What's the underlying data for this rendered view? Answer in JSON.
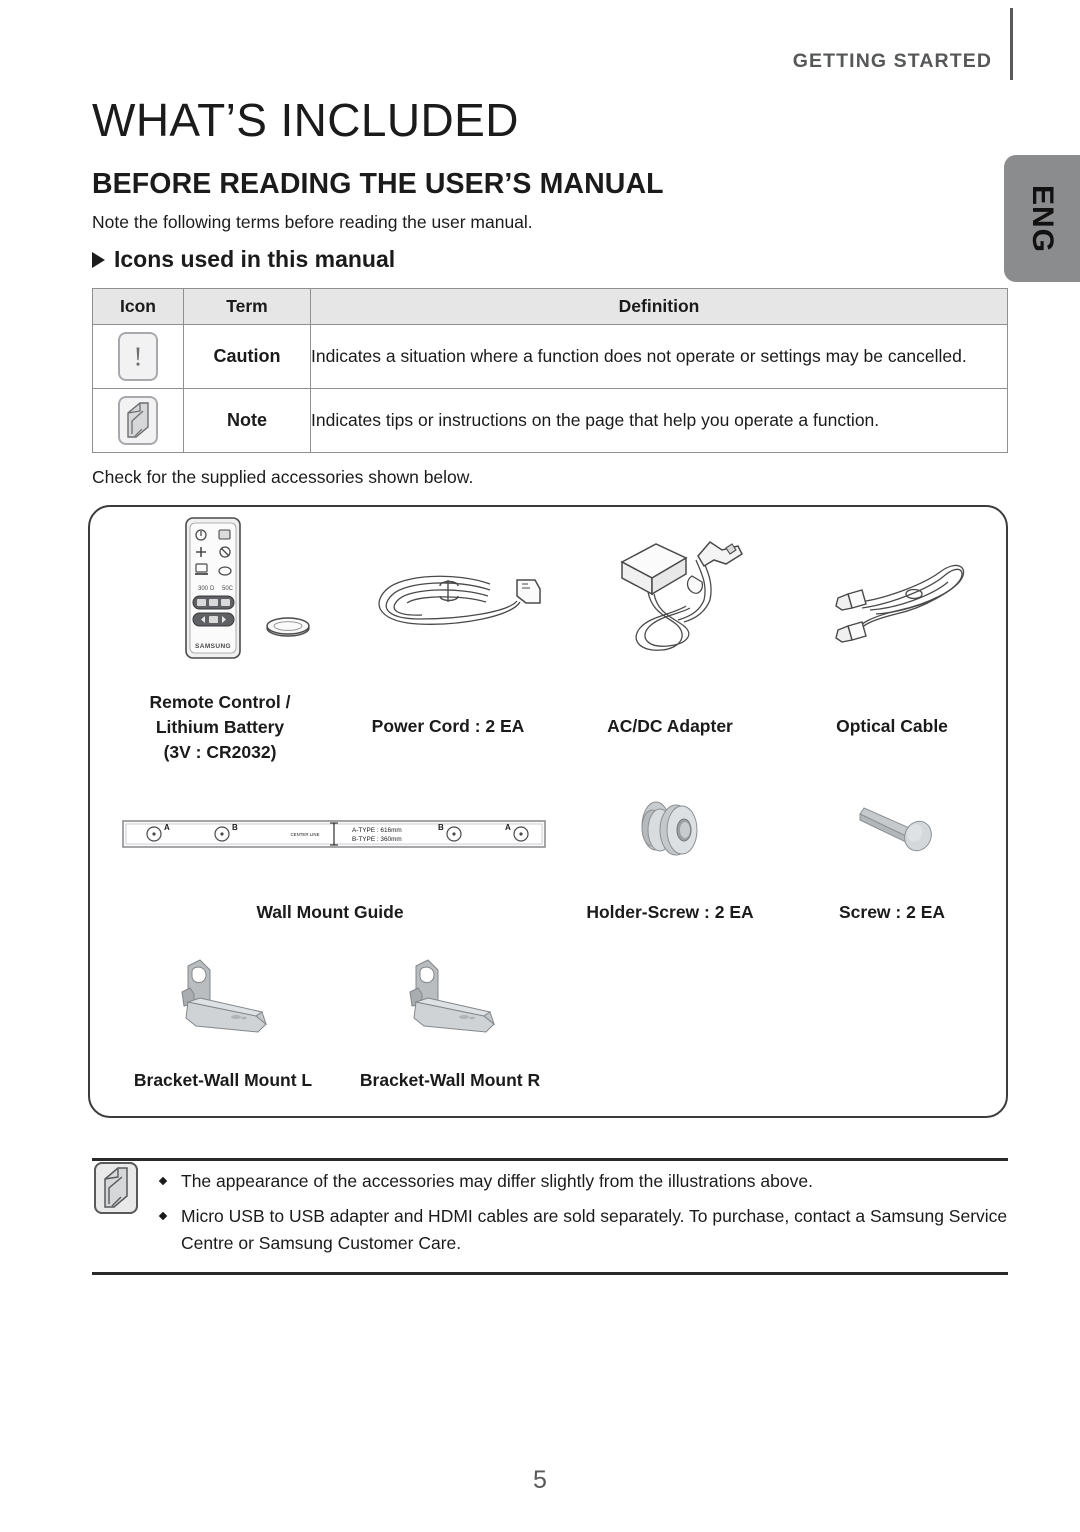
{
  "header": {
    "running_head": "GETTING STARTED",
    "language_tab": "ENG"
  },
  "page_title": "WHAT’S INCLUDED",
  "section_title": "BEFORE READING THE USER’S MANUAL",
  "intro_text": "Note the following terms before reading the user manual.",
  "subhead": "Icons used in this manual",
  "icon_table": {
    "headers": [
      "Icon",
      "Term",
      "Definition"
    ],
    "rows": [
      {
        "icon": "caution-icon",
        "term": "Caution",
        "definition": "Indicates a situation where a function does not operate or settings may be cancelled."
      },
      {
        "icon": "note-icon",
        "term": "Note",
        "definition": "Indicates tips or instructions on the page that help you operate a function."
      }
    ]
  },
  "check_text": "Check for the supplied accessories shown below.",
  "accessories": [
    {
      "icon": "remote-control-icon",
      "label": "Remote Control /\nLithium Battery\n(3V : CR2032)"
    },
    {
      "icon": "power-cord-icon",
      "label": "Power Cord : 2 EA"
    },
    {
      "icon": "ac-dc-adapter-icon",
      "label": "AC/DC Adapter"
    },
    {
      "icon": "optical-cable-icon",
      "label": "Optical Cable"
    },
    {
      "icon": "wall-mount-guide-icon",
      "label": "Wall Mount Guide"
    },
    {
      "icon": "holder-screw-icon",
      "label": "Holder-Screw : 2 EA"
    },
    {
      "icon": "screw-icon",
      "label": "Screw : 2 EA"
    },
    {
      "icon": "bracket-wall-mount-l-icon",
      "label": "Bracket-Wall Mount L"
    },
    {
      "icon": "bracket-wall-mount-r-icon",
      "label": "Bracket-Wall Mount R"
    }
  ],
  "wall_mount_guide": {
    "center_line_label": "CENTER LINE",
    "a_type": "A-TYPE : 616mm",
    "b_type": "B-TYPE : 360mm",
    "markers": [
      "A",
      "B",
      "B",
      "A"
    ]
  },
  "remote": {
    "brand": "SAMSUNG"
  },
  "notes": [
    "The appearance of the accessories may differ slightly from the illustrations above.",
    "Micro USB to USB adapter and HDMI cables are sold separately. To purchase, contact a Samsung Service Centre or Samsung Customer Care."
  ],
  "page_number": "5"
}
